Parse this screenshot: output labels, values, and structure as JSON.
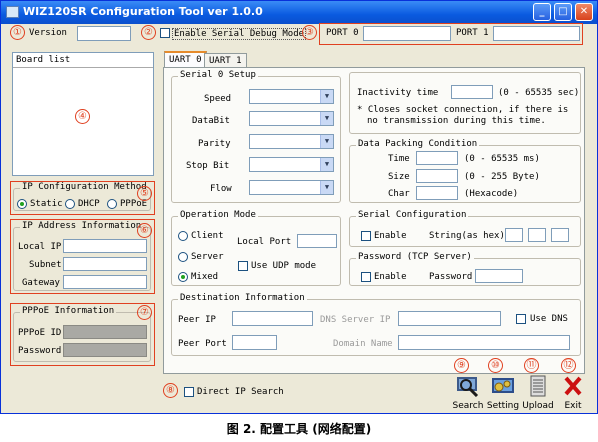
{
  "window": {
    "title": "WIZ120SR Configuration Tool ver 1.0.0",
    "minimize": "_",
    "maximize": "□",
    "close": "✕"
  },
  "markers": [
    "①",
    "②",
    "③",
    "④",
    "⑤",
    "⑥",
    "⑦",
    "⑧",
    "⑨",
    "⑩",
    "⑪",
    "⑫"
  ],
  "header": {
    "version_label": "Version",
    "version_value": "",
    "debug_label": "Enable Serial Debug Mode",
    "port0_label": "PORT 0",
    "port0_value": "",
    "port1_label": "PORT 1",
    "port1_value": ""
  },
  "board_list": {
    "title": "Board list"
  },
  "ip_config": {
    "title": "IP Configuration Method",
    "options": [
      "Static",
      "DHCP",
      "PPPoE"
    ],
    "selected": "Static"
  },
  "ip_info": {
    "title": "IP Address Information",
    "local_ip": "Local IP",
    "subnet": "Subnet",
    "gateway": "Gateway"
  },
  "pppoe": {
    "title": "PPPoE Information",
    "id_label": "PPPoE ID",
    "password_label": "Password"
  },
  "tabs": [
    "UART 0",
    "UART 1"
  ],
  "serial_setup": {
    "title": "Serial 0 Setup",
    "fields": [
      "Speed",
      "DataBit",
      "Parity",
      "Stop Bit",
      "Flow"
    ]
  },
  "inactivity": {
    "label": "Inactivity time",
    "range": "(0 - 65535 sec)",
    "note1": "* Closes socket connection, if there is",
    "note2": "no transmission during this time."
  },
  "packing": {
    "title": "Data Packing Condition",
    "time_label": "Time",
    "time_range": "(0 - 65535 ms)",
    "size_label": "Size",
    "size_range": "(0 - 255 Byte)",
    "char_label": "Char",
    "char_note": "(Hexacode)"
  },
  "operation": {
    "title": "Operation Mode",
    "client": "Client",
    "server": "Server",
    "mixed": "Mixed",
    "selected": "Mixed",
    "local_port": "Local Port",
    "udp": "Use UDP mode"
  },
  "serial_config": {
    "title": "Serial Configuration",
    "enable": "Enable",
    "string_label": "String(as hex)"
  },
  "password": {
    "title": "Password (TCP Server)",
    "enable": "Enable",
    "password_label": "Password"
  },
  "destination": {
    "title": "Destination Information",
    "peer_ip": "Peer IP",
    "dns_ip": "DNS Server IP",
    "use_dns": "Use DNS",
    "peer_port": "Peer Port",
    "domain": "Domain Name"
  },
  "bottom": {
    "direct_search": "Direct IP Search"
  },
  "toolbar": {
    "search": "Search",
    "setting": "Setting",
    "upload": "Upload",
    "exit": "Exit"
  },
  "caption": "图 2. 配置工具 (网络配置)"
}
